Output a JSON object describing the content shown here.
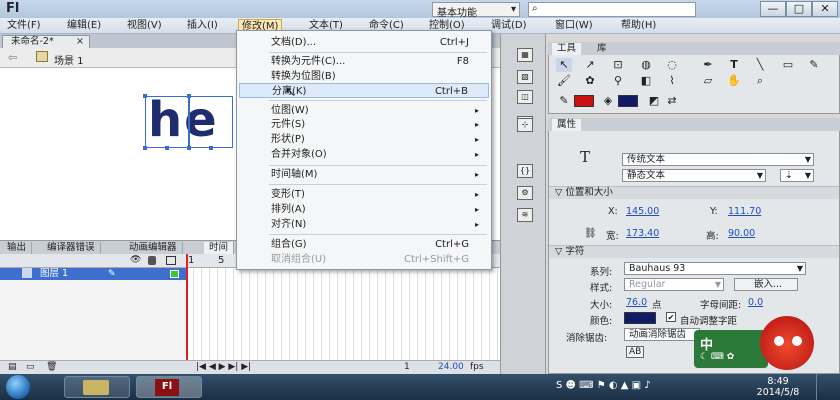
{
  "window": {
    "logo": "Fl",
    "workspace": "基本功能",
    "workspace_arrow": "▾",
    "search_icon": "⌕",
    "controls": [
      "—",
      "□",
      "✕"
    ]
  },
  "menubar": [
    "文件(F)",
    "编辑(E)",
    "视图(V)",
    "插入(I)",
    "修改(M)",
    "文本(T)",
    "命令(C)",
    "控制(O)",
    "调试(D)",
    "窗口(W)",
    "帮助(H)"
  ],
  "document": {
    "tab": "未命名-2*",
    "tab_close": "×",
    "scene": "场景 1",
    "stage_text": "he"
  },
  "dropdown": {
    "items": [
      {
        "label": "文档(D)...",
        "shortcut": "Ctrl+J"
      },
      {
        "label": "转换为元件(C)...",
        "shortcut": "F8"
      },
      {
        "label": "转换为位图(B)",
        "shortcut": ""
      },
      {
        "label": "分离(K)",
        "shortcut": "Ctrl+B"
      },
      {
        "label": "位图(W)",
        "shortcut": ""
      },
      {
        "label": "元件(S)",
        "shortcut": ""
      },
      {
        "label": "形状(P)",
        "shortcut": ""
      },
      {
        "label": "合并对象(O)",
        "shortcut": ""
      },
      {
        "label": "时间轴(M)",
        "shortcut": ""
      },
      {
        "label": "变形(T)",
        "shortcut": ""
      },
      {
        "label": "排列(A)",
        "shortcut": ""
      },
      {
        "label": "对齐(N)",
        "shortcut": ""
      },
      {
        "label": "组合(G)",
        "shortcut": "Ctrl+G"
      },
      {
        "label": "取消组合(U)",
        "shortcut": "Ctrl+Shift+G"
      }
    ],
    "submenu_arrow": "▸"
  },
  "lower_tabs": [
    "输出",
    "编译器错误",
    "动画编辑器",
    "时间"
  ],
  "timeline": {
    "layer_name": "图层 1",
    "frame_numbers": [
      "1",
      "5"
    ],
    "footer_frame": "1",
    "fps": "24.00",
    "fps_unit": "fps"
  },
  "tools": {
    "tabs": [
      "工具",
      "库"
    ]
  },
  "properties": {
    "tab": "属性",
    "type_icon": "T",
    "text_engine": "传统文本",
    "text_type": "静态文本",
    "section_position": "位置和大小",
    "x_label": "X:",
    "x_value": "145.00",
    "y_label": "Y:",
    "y_value": "111.70",
    "w_label": "宽:",
    "w_value": "173.40",
    "h_label": "高:",
    "h_value": "90.00",
    "section_char": "字符",
    "family_label": "系列:",
    "family_value": "Bauhaus 93",
    "style_label": "样式:",
    "style_value": "Regular",
    "embed_button": "嵌入...",
    "size_label": "大小:",
    "size_value": "76.0",
    "size_unit": "点",
    "spacing_label": "字母间距:",
    "spacing_value": "0.0",
    "color_label": "颜色:",
    "auto_kern": "自动调整字距",
    "aa_label": "消除锯齿:",
    "aa_value": "动画消除锯齿"
  },
  "taskbar": {
    "time": "8:49",
    "date": "2014/5/8"
  },
  "colors": {
    "stroke_swatch": "#cc1111",
    "fill_swatch": "#111a66",
    "text_color": "#1f2c6e",
    "accent": "#3f6fcc"
  }
}
